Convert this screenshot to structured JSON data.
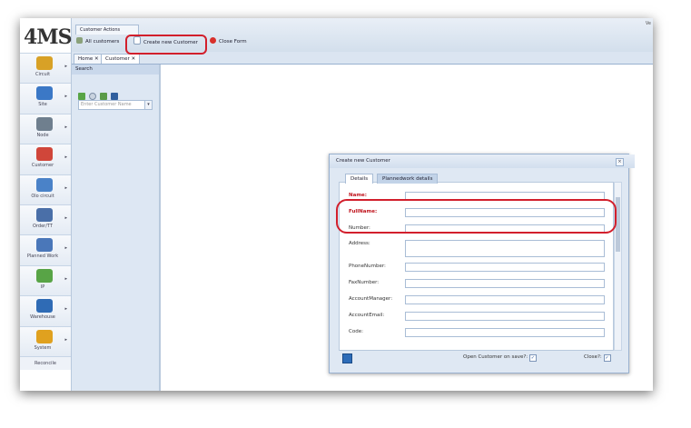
{
  "app": {
    "logo_text": "4MS",
    "version_label": "Ve"
  },
  "nav": {
    "items": [
      {
        "label": "Circuit",
        "icon": "circuit-icon",
        "color": "#d8a126"
      },
      {
        "label": "Site",
        "icon": "site-icon",
        "color": "#3b78c6"
      },
      {
        "label": "Node",
        "icon": "node-icon",
        "color": "#6f7f8e"
      },
      {
        "label": "Customer",
        "icon": "customer-icon",
        "color": "#d0463a"
      },
      {
        "label": "Olo circuit",
        "icon": "olo-circuit-icon",
        "color": "#4a82c8"
      },
      {
        "label": "Order/TT",
        "icon": "order-icon",
        "color": "#4a6fa8"
      },
      {
        "label": "Planned Work",
        "icon": "planned-work-icon",
        "color": "#4a77b9"
      },
      {
        "label": "IP",
        "icon": "ip-icon",
        "color": "#58a446"
      },
      {
        "label": "Warehouse",
        "icon": "warehouse-icon",
        "color": "#2f6bb5"
      },
      {
        "label": "System",
        "icon": "system-icon",
        "color": "#e0a11f"
      }
    ],
    "reconcile_label": "Reconcile"
  },
  "toolbar": {
    "group_title": "Customer Actions",
    "all_customers": "All customers",
    "create_new": "Create new Customer",
    "close_form": "Close Form"
  },
  "tabs": {
    "home": "Home",
    "customer": "Customer"
  },
  "search": {
    "header": "Search",
    "placeholder": "Enter Customer Name"
  },
  "dialog": {
    "title": "Create new Customer",
    "tabs": [
      "Details",
      "Plannedwork details"
    ],
    "fields": [
      {
        "label": "Name:",
        "value": ""
      },
      {
        "label": "FullName:",
        "value": ""
      },
      {
        "label": "Number:",
        "value": ""
      },
      {
        "label": "Address:",
        "value": ""
      },
      {
        "label": "PhoneNumber:",
        "value": ""
      },
      {
        "label": "FaxNumber:",
        "value": ""
      },
      {
        "label": "AccountManager:",
        "value": ""
      },
      {
        "label": "AccountEmail:",
        "value": ""
      },
      {
        "label": "Code:",
        "value": ""
      }
    ],
    "open_on_save_label": "Open Customer on save?:",
    "close_label": "Close?:",
    "open_on_save_checked": true,
    "close_checked": true
  },
  "colors": {
    "highlight": "#d21f2c",
    "required_label": "#c0141d"
  }
}
